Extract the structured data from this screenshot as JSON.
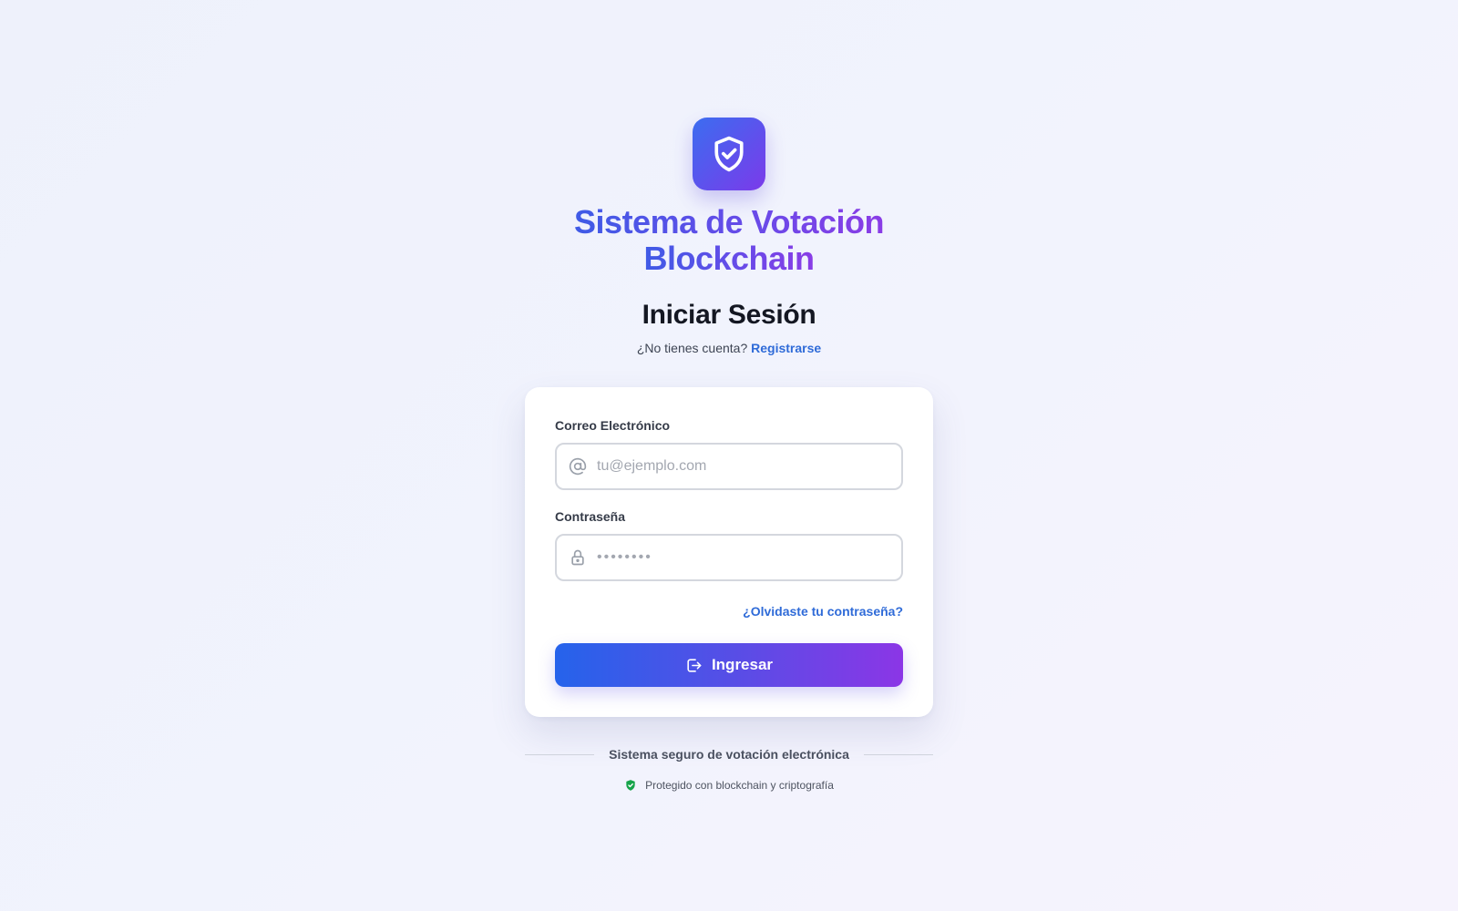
{
  "header": {
    "logo_icon": "shield-check-icon",
    "app_title_line1": "Sistema de Votación",
    "app_title_line2": "Blockchain",
    "page_title": "Iniciar Sesión",
    "signup_prompt": "¿No tienes cuenta?",
    "signup_link": "Registrarse"
  },
  "form": {
    "email_label": "Correo Electrónico",
    "email_placeholder": "tu@ejemplo.com",
    "email_value": "",
    "email_icon": "at-sign-icon",
    "password_label": "Contraseña",
    "password_placeholder": "••••••••",
    "password_value": "",
    "password_icon": "lock-icon",
    "forgot_link": "¿Olvidaste tu contraseña?",
    "submit_label": "Ingresar",
    "submit_icon": "login-icon"
  },
  "footer": {
    "divider_text": "Sistema seguro de votación electrónica",
    "protected_text": "Protegido con blockchain y criptografía",
    "protected_icon": "shield-check-icon"
  },
  "colors": {
    "accent_blue": "#2f6bd8",
    "gradient_start": "#2563eb",
    "gradient_end": "#8b36e6",
    "success_green": "#16a34a"
  }
}
